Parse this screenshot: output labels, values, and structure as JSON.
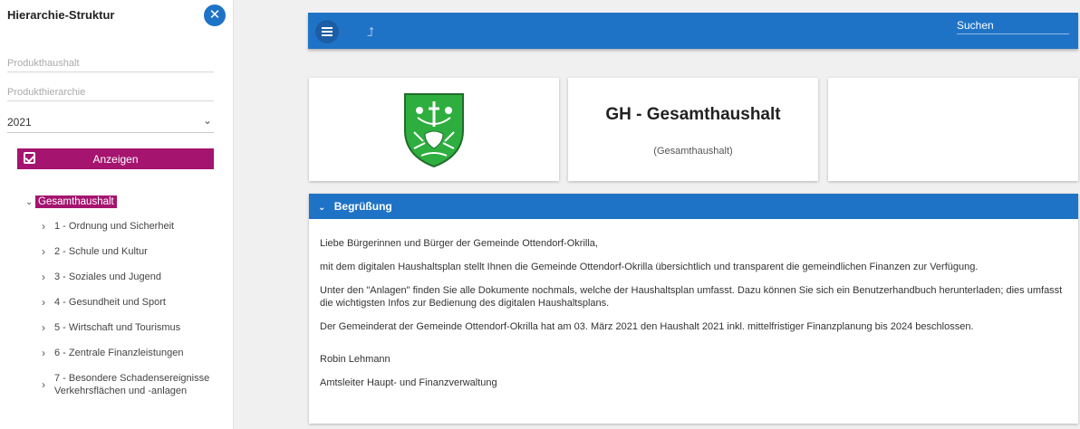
{
  "sidebar": {
    "title": "Hierarchie-Struktur",
    "close_icon": "close-circle-icon",
    "fields": {
      "produkthaushalt_placeholder": "Produkthaushalt",
      "produkthierarchie_placeholder": "Produkthierarchie"
    },
    "year_select": {
      "value": "2021"
    },
    "show_button_label": "Anzeigen",
    "tree": {
      "root_label": "Gesamthaushalt",
      "items": [
        {
          "label": "1 - Ordnung und Sicherheit"
        },
        {
          "label": "2 - Schule und Kultur"
        },
        {
          "label": "3 - Soziales und Jugend"
        },
        {
          "label": "4 - Gesundheit und Sport"
        },
        {
          "label": "5 - Wirtschaft und Tourismus"
        },
        {
          "label": "6 - Zentrale Finanzleistungen"
        },
        {
          "label_line1": "7 - Besondere Schadensereignisse",
          "label_line2": "Verkehrsflächen und -anlagen"
        }
      ]
    }
  },
  "topbar": {
    "menu_icon": "hamburger-menu-icon",
    "up_icon": "arrow-up-icon",
    "search_placeholder": "Suchen"
  },
  "cards": {
    "title": "GH - Gesamthaushalt",
    "subtitle": "(Gesamthaushalt)"
  },
  "welcome": {
    "heading": "Begrüßung",
    "paragraphs": [
      "Liebe Bürgerinnen und Bürger der Gemeinde Ottendorf-Okrilla,",
      "mit dem digitalen Haushaltsplan stellt Ihnen die Gemeinde Ottendorf-Okrilla übersichtlich und transparent die gemeindlichen Finanzen zur Verfügung.",
      "Unter den \"Anlagen\" finden Sie alle Dokumente nochmals, welche der Haushaltsplan umfasst. Dazu können Sie sich ein Benutzerhandbuch herunterladen; dies umfasst die wichtigsten Infos zur Bedienung des digitalen Haushaltsplans.",
      "Der Gemeinderat der Gemeinde Ottendorf-Okrilla hat am 03. März 2021 den Haushalt 2021 inkl. mittelfristiger Finanzplanung bis 2024 beschlossen."
    ],
    "signature_name": "Robin Lehmann",
    "signature_role": "Amtsleiter Haupt- und Finanzverwaltung"
  },
  "colors": {
    "primary_blue": "#1f73c6",
    "accent_magenta": "#a5146f",
    "crest_green": "#2eae3e"
  }
}
